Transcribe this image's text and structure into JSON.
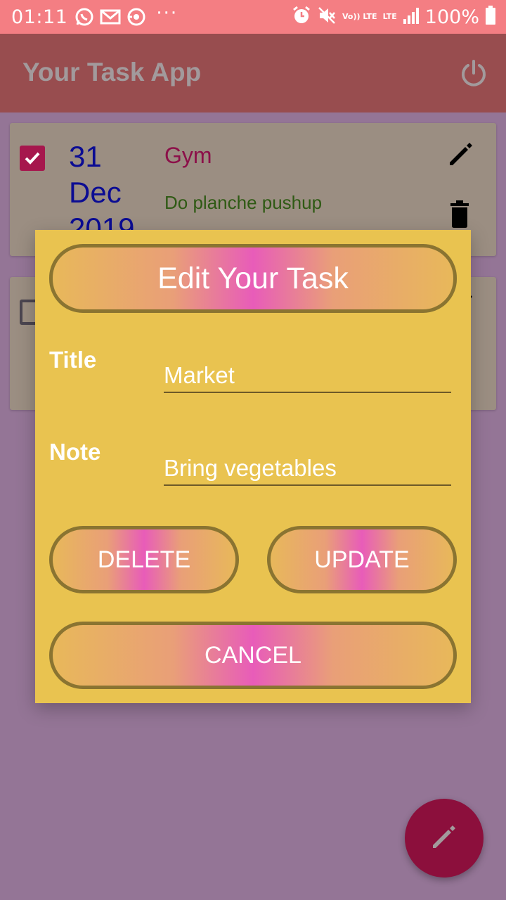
{
  "status_bar": {
    "time": "01:11",
    "lte_top": "Vo)) LTE",
    "lte_bottom": "LTE",
    "battery": "100%",
    "overflow": "···",
    "icons": [
      "whatsapp-icon",
      "gmail-icon",
      "sync-icon",
      "alarm-icon",
      "mute-icon",
      "volte-icon",
      "lte-icon",
      "signal-icon",
      "battery-icon"
    ]
  },
  "app_bar": {
    "title": "Your Task App",
    "action_icon": "power-icon"
  },
  "tasks": [
    {
      "checked": true,
      "date": "31\nDec\n2019",
      "title": "Gym",
      "note": "Do planche pushup"
    },
    {
      "checked": false,
      "date": "",
      "title": "",
      "note": ""
    }
  ],
  "dialog": {
    "header": "Edit Your Task",
    "title_label": "Title",
    "title_value": "Market",
    "note_label": "Note",
    "note_value": "Bring vegetables",
    "delete_label": "DELETE",
    "update_label": "UPDATE",
    "cancel_label": "CANCEL"
  },
  "fab": {
    "icon": "edit-icon"
  },
  "colors": {
    "status_bar": "#f47e83",
    "app_bar": "#984d4f",
    "background": "#947596",
    "card": "#9b8e82",
    "dialog": "#e9c350",
    "accent": "#8c0f3c",
    "date_text": "#0b0c93",
    "title_text": "#8c1049",
    "note_text": "#2f5a14"
  }
}
